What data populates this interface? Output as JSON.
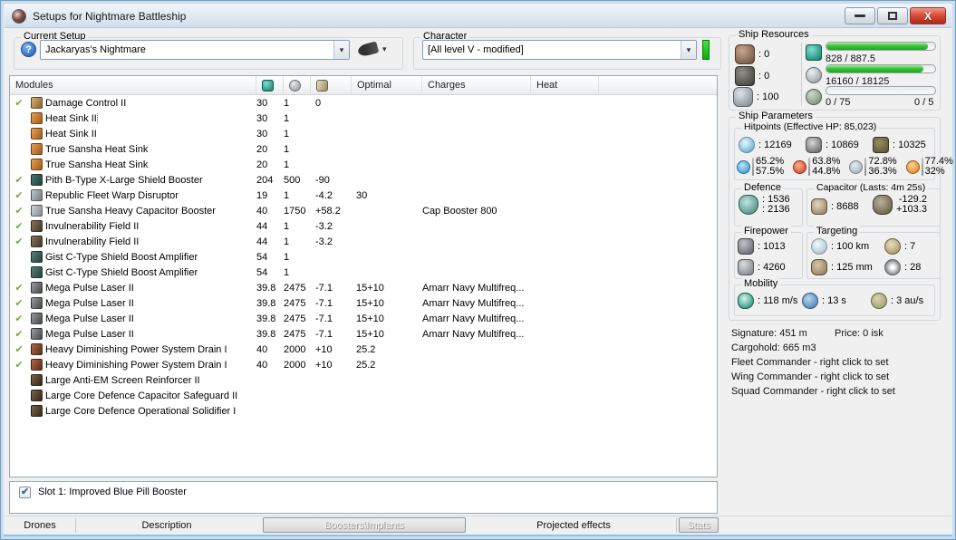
{
  "window": {
    "title": "Setups for Nightmare Battleship"
  },
  "setup": {
    "label": "Current Setup",
    "value": "Jackaryas's Nightmare"
  },
  "character": {
    "label": "Character",
    "value": "[All level V - modified]"
  },
  "modules": {
    "header": {
      "name": "Modules",
      "optimal": "Optimal",
      "charges": "Charges",
      "heat": "Heat"
    },
    "icon_colors": {
      "damage-control": "linear-gradient(120deg,#d8b070,#8a6430)",
      "heat-sink": "linear-gradient(120deg,#e8a050,#a05a1a)",
      "shield-booster": "linear-gradient(120deg,#4a7a72,#1e3f3a)",
      "warp-disruptor": "linear-gradient(120deg,#c0c8cc,#707a80)",
      "cap-booster": "linear-gradient(120deg,#d0d4d6,#84898c)",
      "invuln-field": "linear-gradient(120deg,#8a7458,#41372a)",
      "shield-amp": "linear-gradient(120deg,#5a8078,#263f3a)",
      "pulse-laser": "linear-gradient(120deg,#9a9ca0,#45464a)",
      "nosferatu": "linear-gradient(120deg,#b06848,#5c2e1c)",
      "rig": "linear-gradient(120deg,#7a6448,#36291a)"
    },
    "rows": [
      {
        "active": true,
        "focused": false,
        "icon": "damage-control",
        "name": "Damage Control II",
        "cpu": "30",
        "pg": "1",
        "cap": "0",
        "optimal": "",
        "charges": "",
        "heat": ""
      },
      {
        "active": false,
        "focused": true,
        "icon": "heat-sink",
        "name": "Heat Sink II",
        "cpu": "30",
        "pg": "1",
        "cap": "",
        "optimal": "",
        "charges": "",
        "heat": ""
      },
      {
        "active": false,
        "focused": false,
        "icon": "heat-sink",
        "name": "Heat Sink II",
        "cpu": "30",
        "pg": "1",
        "cap": "",
        "optimal": "",
        "charges": "",
        "heat": ""
      },
      {
        "active": false,
        "focused": false,
        "icon": "heat-sink",
        "name": "True Sansha Heat Sink",
        "cpu": "20",
        "pg": "1",
        "cap": "",
        "optimal": "",
        "charges": "",
        "heat": ""
      },
      {
        "active": false,
        "focused": false,
        "icon": "heat-sink",
        "name": "True Sansha Heat Sink",
        "cpu": "20",
        "pg": "1",
        "cap": "",
        "optimal": "",
        "charges": "",
        "heat": ""
      },
      {
        "active": true,
        "focused": false,
        "icon": "shield-booster",
        "name": "Pith B-Type X-Large Shield Booster",
        "cpu": "204",
        "pg": "500",
        "cap": "-90",
        "optimal": "",
        "charges": "",
        "heat": ""
      },
      {
        "active": true,
        "focused": false,
        "icon": "warp-disruptor",
        "name": "Republic Fleet Warp Disruptor",
        "cpu": "19",
        "pg": "1",
        "cap": "-4.2",
        "optimal": "30",
        "charges": "",
        "heat": ""
      },
      {
        "active": true,
        "focused": false,
        "icon": "cap-booster",
        "name": "True Sansha Heavy Capacitor Booster",
        "cpu": "40",
        "pg": "1750",
        "cap": "+58.2",
        "optimal": "",
        "charges": "Cap Booster 800",
        "heat": ""
      },
      {
        "active": true,
        "focused": false,
        "icon": "invuln-field",
        "name": "Invulnerability Field II",
        "cpu": "44",
        "pg": "1",
        "cap": "-3.2",
        "optimal": "",
        "charges": "",
        "heat": ""
      },
      {
        "active": true,
        "focused": false,
        "icon": "invuln-field",
        "name": "Invulnerability Field II",
        "cpu": "44",
        "pg": "1",
        "cap": "-3.2",
        "optimal": "",
        "charges": "",
        "heat": ""
      },
      {
        "active": false,
        "focused": false,
        "icon": "shield-amp",
        "name": "Gist C-Type Shield Boost Amplifier",
        "cpu": "54",
        "pg": "1",
        "cap": "",
        "optimal": "",
        "charges": "",
        "heat": ""
      },
      {
        "active": false,
        "focused": false,
        "icon": "shield-amp",
        "name": "Gist C-Type Shield Boost Amplifier",
        "cpu": "54",
        "pg": "1",
        "cap": "",
        "optimal": "",
        "charges": "",
        "heat": ""
      },
      {
        "active": true,
        "focused": false,
        "icon": "pulse-laser",
        "name": "Mega Pulse Laser II",
        "cpu": "39.8",
        "pg": "2475",
        "cap": "-7.1",
        "optimal": "15+10",
        "charges": "Amarr Navy Multifreq...",
        "heat": ""
      },
      {
        "active": true,
        "focused": false,
        "icon": "pulse-laser",
        "name": "Mega Pulse Laser II",
        "cpu": "39.8",
        "pg": "2475",
        "cap": "-7.1",
        "optimal": "15+10",
        "charges": "Amarr Navy Multifreq...",
        "heat": ""
      },
      {
        "active": true,
        "focused": false,
        "icon": "pulse-laser",
        "name": "Mega Pulse Laser II",
        "cpu": "39.8",
        "pg": "2475",
        "cap": "-7.1",
        "optimal": "15+10",
        "charges": "Amarr Navy Multifreq...",
        "heat": ""
      },
      {
        "active": true,
        "focused": false,
        "icon": "pulse-laser",
        "name": "Mega Pulse Laser II",
        "cpu": "39.8",
        "pg": "2475",
        "cap": "-7.1",
        "optimal": "15+10",
        "charges": "Amarr Navy Multifreq...",
        "heat": ""
      },
      {
        "active": true,
        "focused": false,
        "icon": "nosferatu",
        "name": "Heavy Diminishing Power System Drain I",
        "cpu": "40",
        "pg": "2000",
        "cap": "+10",
        "optimal": "25.2",
        "charges": "",
        "heat": ""
      },
      {
        "active": true,
        "focused": false,
        "icon": "nosferatu",
        "name": "Heavy Diminishing Power System Drain I",
        "cpu": "40",
        "pg": "2000",
        "cap": "+10",
        "optimal": "25.2",
        "charges": "",
        "heat": ""
      },
      {
        "active": false,
        "focused": false,
        "icon": "rig",
        "name": "Large Anti-EM Screen Reinforcer II",
        "cpu": "",
        "pg": "",
        "cap": "",
        "optimal": "",
        "charges": "",
        "heat": ""
      },
      {
        "active": false,
        "focused": false,
        "icon": "rig",
        "name": "Large Core Defence Capacitor Safeguard II",
        "cpu": "",
        "pg": "",
        "cap": "",
        "optimal": "",
        "charges": "",
        "heat": ""
      },
      {
        "active": false,
        "focused": false,
        "icon": "rig",
        "name": "Large Core Defence Operational Solidifier I",
        "cpu": "",
        "pg": "",
        "cap": "",
        "optimal": "",
        "charges": "",
        "heat": ""
      }
    ]
  },
  "resources": {
    "title": "Ship Resources",
    "turrets": ": 0",
    "launchers": ": 0",
    "calibration": ": 100",
    "cpu": {
      "text": "828 / 887.5",
      "pct": 93
    },
    "powergrid": {
      "text": "16160 / 18125",
      "pct": 89
    },
    "drones": {
      "left": "0 / 75",
      "right": "0 / 5",
      "pct": 0
    }
  },
  "parameters": {
    "title": "Ship Parameters",
    "hitpoints": {
      "title": "Hitpoints (Effective HP: 85,023)",
      "shield": ": 12169",
      "armor": ": 10869",
      "structure": ": 10325",
      "resists": [
        {
          "icon": "em-resist-icon",
          "cls": "ic-em",
          "top": "65.2%",
          "bottom": "57.5%"
        },
        {
          "icon": "thermal-resist-icon",
          "cls": "ic-thermal",
          "top": "63.8%",
          "bottom": "44.8%"
        },
        {
          "icon": "kinetic-resist-icon",
          "cls": "ic-kinetic",
          "top": "72.8%",
          "bottom": "36.3%"
        },
        {
          "icon": "explosive-resist-icon",
          "cls": "ic-explosive",
          "top": "77.4%",
          "bottom": "32%"
        }
      ]
    },
    "defence": {
      "title": "Defence",
      "v1": ": 1536",
      "v2": ": 2136"
    },
    "capacitor": {
      "title": "Capacitor (Lasts: 4m 25s)",
      "amount": ": 8688",
      "out": "-129.2",
      "in": "+103.3"
    },
    "firepower": {
      "title": "Firepower",
      "dps": ": 1013",
      "volley": ": 4260"
    },
    "targeting": {
      "title": "Targeting",
      "range": ": 100 km",
      "maxtargets": ": 7",
      "scanres": ": 125 mm",
      "sensor": ": 28"
    },
    "mobility": {
      "title": "Mobility",
      "speed": ": 118 m/s",
      "align": ": 13 s",
      "warp": ": 3 au/s"
    },
    "info": {
      "signature": "Signature: 451 m",
      "price": "Price: 0 isk",
      "cargohold": "Cargohold: 665 m3",
      "fleet": "Fleet Commander - right click to set",
      "wing": "Wing Commander - right click to set",
      "squad": "Squad Commander - right click to set"
    }
  },
  "booster": {
    "checked": true,
    "label": "Slot 1: Improved Blue Pill Booster"
  },
  "tabs": {
    "drones": "Drones",
    "description": "Description",
    "boosters": "Boosters\\Implants",
    "projected": "Projected effects",
    "stats": "Stats"
  }
}
